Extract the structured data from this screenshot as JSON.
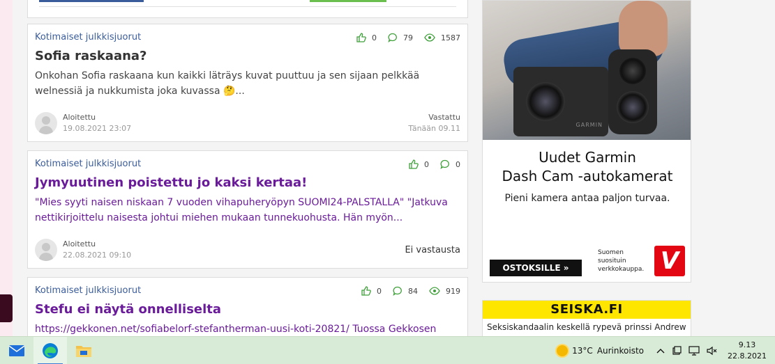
{
  "posts": [
    {
      "category": "Kotimaiset julkkisjuorut",
      "likes": "0",
      "comments": "79",
      "views": "1587",
      "title": "Sofia raskaana?",
      "excerpt": "Onkohan Sofia raskaana kun kaikki läträys kuvat puuttuu ja sen sijaan pelkkää welnessiä ja nukkumista joka kuvassa 🤔...",
      "started_label": "Aloitettu",
      "started_date": "19.08.2021 23:07",
      "replied_label": "Vastattu",
      "replied_date": "Tänään 09.11"
    },
    {
      "category": "Kotimaiset julkkisjuorut",
      "likes": "0",
      "comments": "0",
      "title": "Jymyuutinen poistettu jo kaksi kertaa!",
      "excerpt": "\"Mies syyti naisen niskaan 7 vuoden vihapuheryöpyn SUOMI24-PALSTALLA\" \"Jatkuva nettikirjoittelu naisesta johtui miehen mukaan tunnekuohusta. Hän myön...",
      "started_label": "Aloitettu",
      "started_date": "22.08.2021 09:10",
      "no_replies": "Ei vastausta"
    },
    {
      "category": "Kotimaiset julkkisjuorut",
      "likes": "0",
      "comments": "84",
      "views": "919",
      "title": "Stefu ei näytä onnelliselta",
      "excerpt": "https://gekkonen.net/sofiabelorf-stefantherman-uusi-koti-20821/ Tuossa Gekkosen"
    }
  ],
  "ad": {
    "brand_on_camera": "GARMIN",
    "headline_line1": "Uudet Garmin",
    "headline_line2": "Dash Cam -autokamerat",
    "subline": "Pieni kamera antaa paljon turvaa.",
    "shop_button": "OSTOKSILLE »",
    "tagline_1": "Suomen",
    "tagline_2": "suosituin",
    "tagline_3": "verkkokauppa.",
    "logo_letter": "V",
    "logo_color": "#e30613"
  },
  "seiska": {
    "brand": "SEISKA.FI",
    "headline": "Seksiskandaalin keskellä rypevä prinssi Andrew",
    "bar_color": "#ffe600"
  },
  "taskbar": {
    "apps": [
      "mail-icon",
      "edge-icon",
      "file-explorer-icon"
    ],
    "weather_temp": "13°C",
    "weather_text": "Aurinkoisto",
    "time": "9.13",
    "date": "22.8.2021"
  }
}
